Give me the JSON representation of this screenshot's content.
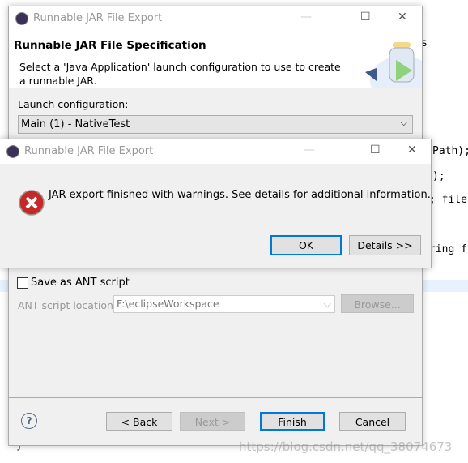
{
  "background_code": {
    "l1": "s",
    "l2": "Path);",
    "l3": ");",
    "l4": "; filePa",
    "l5": "ring fi",
    "l6": "}"
  },
  "wizard": {
    "title": "Runnable JAR File Export",
    "heading": "Runnable JAR File Specification",
    "description": "Select a 'Java Application' launch configuration to use to create a runnable JAR.",
    "launch_label": "Launch configuration:",
    "launch_value": "Main (1) - NativeTest",
    "save_ant_label": "Save as ANT script",
    "save_ant_checked": false,
    "ant_location_label": "ANT script location:",
    "ant_location_value": "F:\\eclipseWorkspace",
    "browse": "Browse...",
    "back": "< Back",
    "next": "Next >",
    "finish": "Finish",
    "cancel": "Cancel"
  },
  "alert": {
    "title": "Runnable JAR File Export",
    "message": "JAR export finished with warnings. See details for additional information.",
    "ok": "OK",
    "details": "Details >>"
  },
  "watermark": "https://blog.csdn.net/qq_38074673",
  "colors": {
    "accent": "#0078d7",
    "error": "#c62828"
  }
}
